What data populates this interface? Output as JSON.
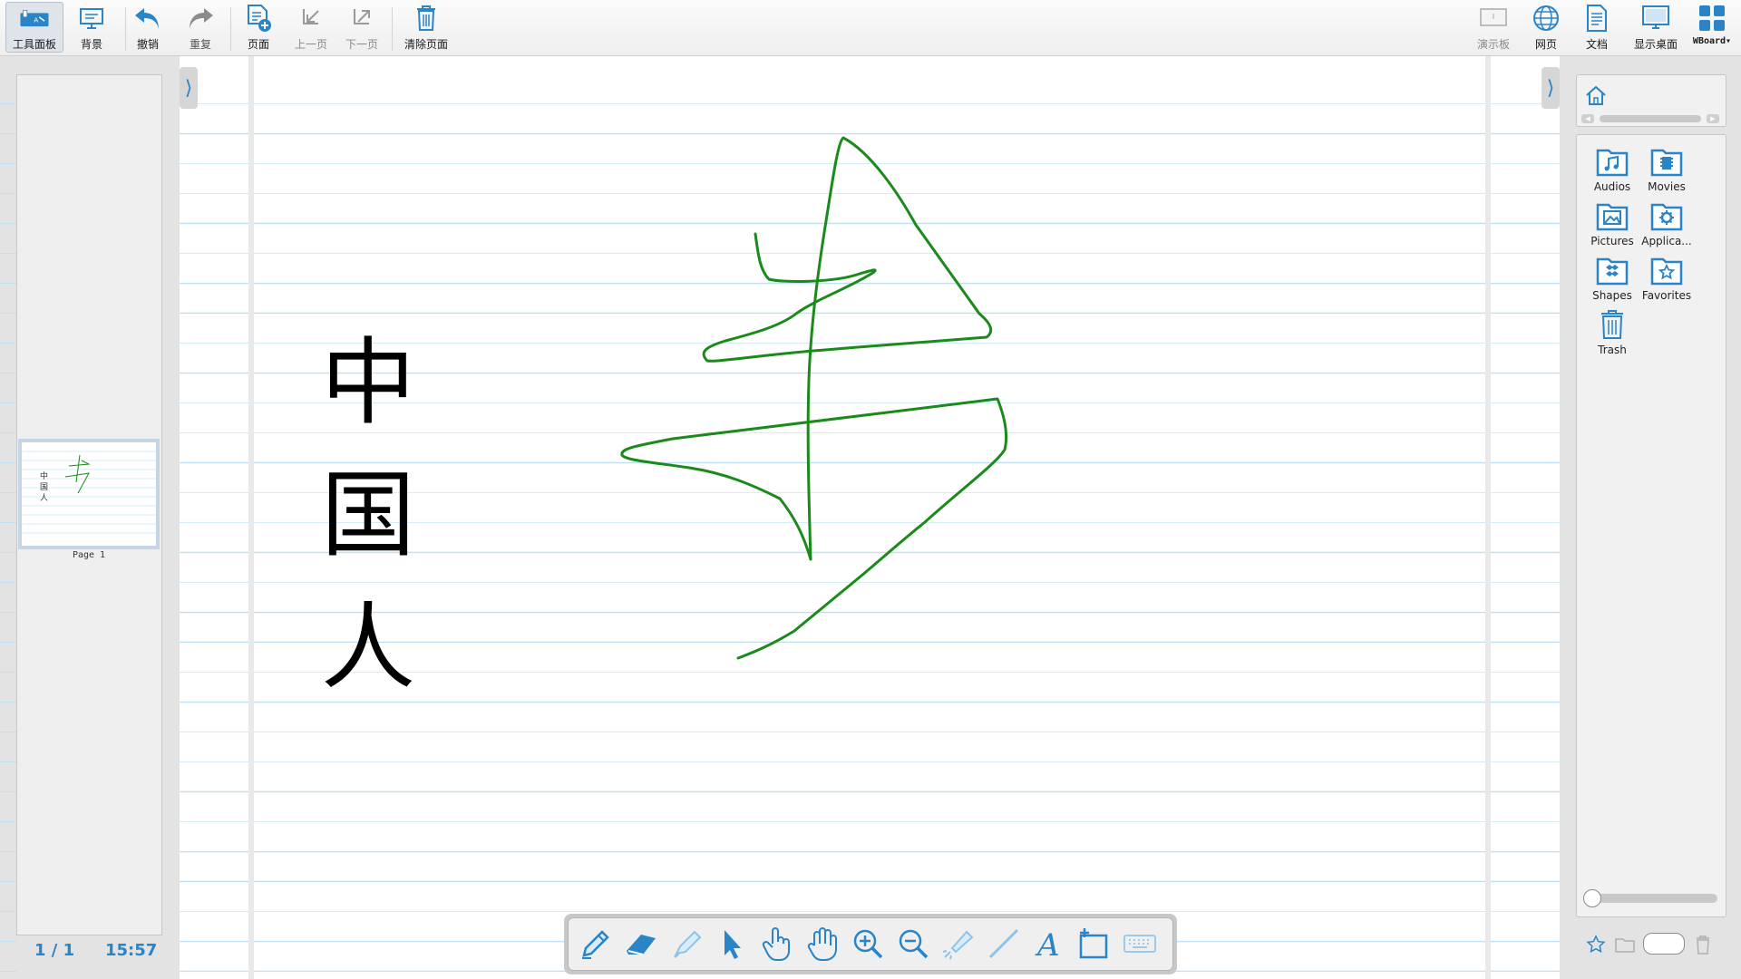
{
  "toolbar": {
    "left": [
      {
        "id": "tool-panel",
        "label": "工具面板",
        "icon": "tool-panel-icon",
        "active": true
      },
      {
        "id": "background",
        "label": "背景",
        "icon": "background-icon"
      },
      {
        "id": "undo",
        "label": "撤销",
        "icon": "undo-icon"
      },
      {
        "id": "redo",
        "label": "重复",
        "icon": "redo-icon"
      },
      {
        "id": "add-page",
        "label": "页面",
        "icon": "add-page-icon"
      },
      {
        "id": "prev-page",
        "label": "上一页",
        "icon": "prev-page-icon",
        "disabled": true
      },
      {
        "id": "next-page",
        "label": "下一页",
        "icon": "next-page-icon",
        "disabled": true
      },
      {
        "id": "clear-page",
        "label": "清除页面",
        "icon": "trash-icon"
      }
    ],
    "right": [
      {
        "id": "presentation",
        "label": "演示板",
        "icon": "presentation-board-icon",
        "disabled": true
      },
      {
        "id": "web",
        "label": "网页",
        "icon": "globe-icon"
      },
      {
        "id": "document",
        "label": "文档",
        "icon": "document-icon"
      },
      {
        "id": "desktop",
        "label": "显示桌面",
        "icon": "monitor-icon"
      },
      {
        "id": "wboard",
        "label": "WBoard",
        "icon": "app-grid-icon"
      }
    ]
  },
  "pages": {
    "thumbnail_label": "Page 1",
    "counter": "1 / 1",
    "clock": "15:57"
  },
  "canvas": {
    "characters": [
      "中",
      "国",
      "人"
    ],
    "ink_color": "#1a8a1a"
  },
  "library": {
    "items": [
      {
        "label": "Audios",
        "icon": "audio-folder-icon"
      },
      {
        "label": "Movies",
        "icon": "movie-folder-icon"
      },
      {
        "label": "Pictures",
        "icon": "picture-folder-icon"
      },
      {
        "label": "Applica...",
        "icon": "application-folder-icon"
      },
      {
        "label": "Shapes",
        "icon": "shapes-folder-icon"
      },
      {
        "label": "Favorites",
        "icon": "favorites-folder-icon"
      },
      {
        "label": "Trash",
        "icon": "trash-icon"
      }
    ]
  },
  "pen_tools": [
    "pen-icon",
    "eraser-icon",
    "marker-icon",
    "selector-icon",
    "interact-hand-icon",
    "pan-hand-icon",
    "zoom-in-icon",
    "zoom-out-icon",
    "laser-pointer-icon",
    "line-icon",
    "text-icon",
    "capture-icon",
    "keyboard-icon"
  ],
  "colors": {
    "accent": "#2a84c8",
    "ruled_line": "#bfe0f2",
    "ink": "#1a8a1a"
  }
}
